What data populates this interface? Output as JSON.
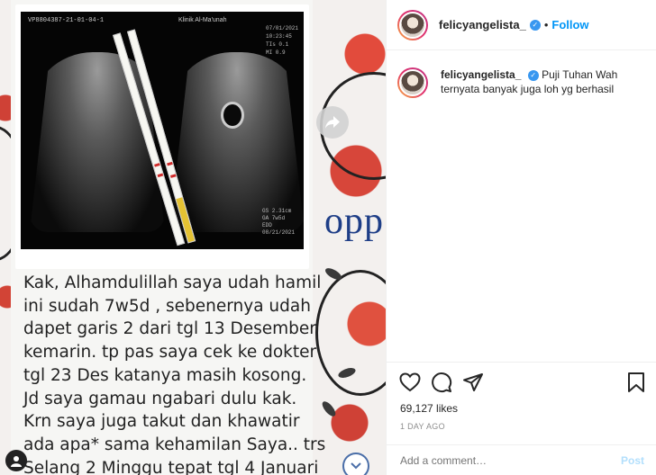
{
  "post": {
    "username": "felicyangelista_",
    "verified_icon": "verified-badge-icon",
    "separator": "•",
    "follow_label": "Follow",
    "caption_text": "Puji Tuhan Wah ternyata banyak juga loh yg berhasil",
    "likes": "69,127 likes",
    "time_ago": "1 DAY AGO",
    "comment_placeholder": "Add a comment…",
    "post_label": "Post"
  },
  "media": {
    "scan_header": "VP8804387-21-01-04-1",
    "scan_clinic": "Klinik Al-Ma'unah",
    "scan_right_lines": [
      "07/01/2021",
      "10:23:45",
      "TIs 0.1",
      "MI 0.9"
    ],
    "scan_footer_lines": [
      "GS 2.31cm",
      "GA 7w5d",
      "EDD 08/21/2021"
    ],
    "opp_text": "opp",
    "message_lines": [
      "Kak, Alhamdulillah saya udah hamil",
      "ini sudah 7w5d , sebenernya udah",
      "dapet garis 2 dari tgl 13 Desember",
      "kemarin. tp pas saya cek ke dokter",
      "tgl 23 Des katanya masih kosong.",
      "Jd saya gamau ngabari dulu kak.",
      "Krn saya juga takut dan khawatir",
      "ada apa* sama kehamilan Saya.. trs",
      "Selang 2 Minggu tepat tgl 4 Januari"
    ]
  },
  "icons": {
    "like": "heart-icon",
    "comment": "comment-icon",
    "share": "paper-plane-icon",
    "save": "bookmark-icon",
    "next": "share-arrow-icon",
    "down": "chevron-down-icon"
  },
  "colors": {
    "link_blue": "#0095f6",
    "verified_blue": "#3897f0",
    "text": "#262626",
    "muted": "#8e8e8e"
  }
}
